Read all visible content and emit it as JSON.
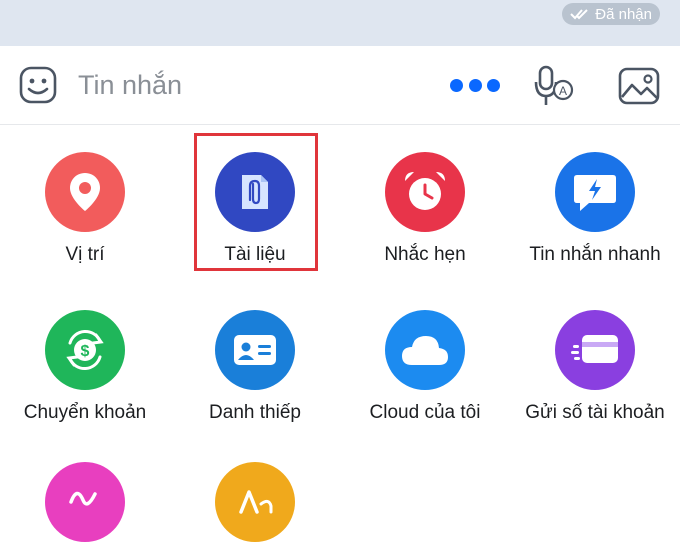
{
  "chat": {
    "status_badge": "Đã nhận",
    "status_icon": "double-check-icon"
  },
  "composer": {
    "sticker_icon": "sticker-face-icon",
    "placeholder": "Tin nhắn",
    "more_icon": "more-dots-icon",
    "voice_icon": "voice-to-text-icon",
    "image_icon": "image-icon",
    "accent_color": "#0a68ff"
  },
  "actions": [
    {
      "label": "Vị trí",
      "icon": "location-pin-icon",
      "color": "#f25c5c",
      "selected": false
    },
    {
      "label": "Tài liệu",
      "icon": "paperclip-document-icon",
      "color": "#3048c2",
      "selected": true
    },
    {
      "label": "Nhắc hẹn",
      "icon": "alarm-clock-icon",
      "color": "#e8344a",
      "selected": false
    },
    {
      "label": "Tin nhắn nhanh",
      "icon": "lightning-chat-icon",
      "color": "#1a73e8",
      "selected": false
    },
    {
      "label": "Chuyển khoản",
      "icon": "money-transfer-icon",
      "color": "#1fb65a",
      "selected": false
    },
    {
      "label": "Danh thiếp",
      "icon": "business-card-icon",
      "color": "#1a7fd9",
      "selected": false
    },
    {
      "label": "Cloud của tôi",
      "icon": "cloud-icon",
      "color": "#1c8bf0",
      "selected": false
    },
    {
      "label": "Gửi số tài khoản",
      "icon": "credit-card-icon",
      "color": "#8a3fe0",
      "selected": false
    }
  ],
  "partial_row": [
    {
      "icon": "doodle-icon",
      "color": "#e83fbf"
    },
    {
      "icon": "font-style-icon",
      "color": "#f0a91c"
    }
  ],
  "highlight_color": "#e0353b"
}
